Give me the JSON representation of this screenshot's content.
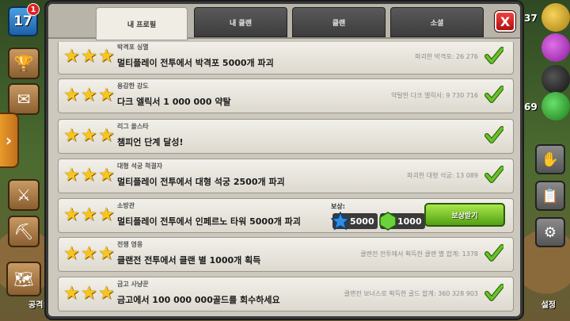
{
  "hud": {
    "level": "17",
    "notification_count": "1",
    "attack_label": "공격!",
    "resource_counts": [
      "37",
      "",
      "",
      "69"
    ],
    "settings_label": "설정"
  },
  "tabs": [
    {
      "label": "내 프로필",
      "active": true
    },
    {
      "label": "내 클랜",
      "active": false
    },
    {
      "label": "클랜",
      "active": false
    },
    {
      "label": "소셜",
      "active": false
    }
  ],
  "close_label": "X",
  "achievements": [
    {
      "name": "박격포 싱멸",
      "desc": "멀티플레이 전투에서 박격포 5000개 파괴",
      "progress": "파괴한 박격포: 26 276",
      "stars": 3,
      "completed": true
    },
    {
      "name": "용감한 강도",
      "desc": "다크 엘릭서 1 000 000 약탈",
      "progress": "약탈한 다크 엘릭서: 9 730 716",
      "stars": 3,
      "completed": true
    },
    {
      "name": "리그 올스타",
      "desc": "챔피언 단계 달성!",
      "progress": "",
      "stars": 3,
      "completed": true
    },
    {
      "name": "대형 석궁 척결자",
      "desc": "멀티플레이 전투에서 대형 석궁 2500개 파괴",
      "progress": "파괴한 대형 석궁: 13 089",
      "stars": 3,
      "completed": true
    },
    {
      "name": "소방관",
      "desc": "멀티플레이 전투에서 인페르노 타워 5000개 파괴",
      "progress": "",
      "stars": 3,
      "completed": false,
      "reward": {
        "label": "보상:",
        "xp": "5000",
        "gems": "1000",
        "claim_label": "보상받기"
      }
    },
    {
      "name": "전쟁 영웅",
      "desc": "클랜전 전투에서 클랜 별 1000개 획득",
      "progress": "클랜전 전투에서 획득한 클랜 별 합계: 1378",
      "stars": 3,
      "completed": true
    },
    {
      "name": "금고 사냥꾼",
      "desc": "금고에서 100 000 000골드를 회수하세요",
      "progress": "클랜전 보너스로 획득한 골드 합계: 360 328 903",
      "stars": 3,
      "completed": true
    }
  ],
  "colors": {
    "star": "#f7c51e",
    "check": "#6cc32a",
    "claim_button": "#6fc22a",
    "close_button": "#d82a2a"
  },
  "icons": [
    "trophy-icon",
    "mail-icon",
    "sword-icon",
    "builder-icon",
    "map-icon",
    "star-icon",
    "check-icon",
    "xp-star-icon",
    "gem-icon",
    "hand-icon",
    "clipboard-icon",
    "gear-icon"
  ]
}
